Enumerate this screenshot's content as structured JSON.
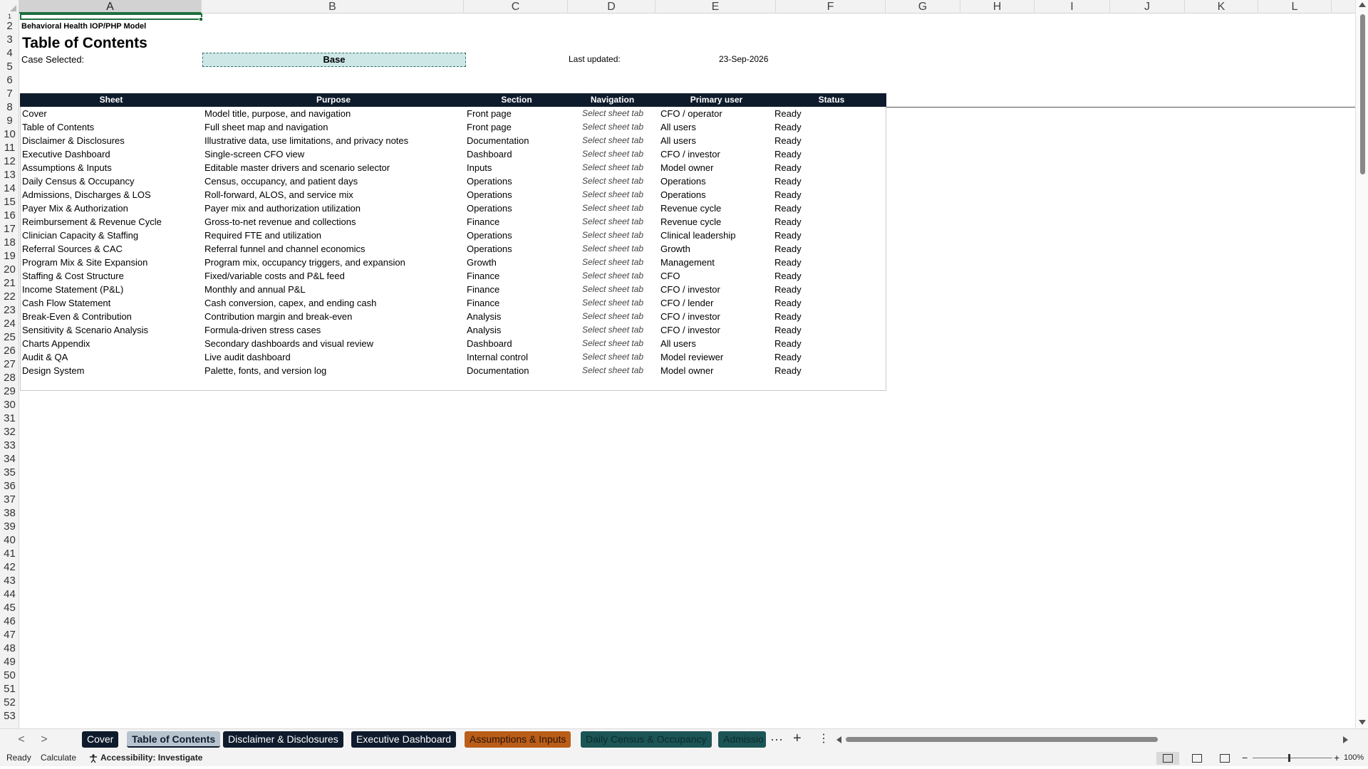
{
  "columns": [
    "A",
    "B",
    "C",
    "D",
    "E",
    "F",
    "G",
    "H",
    "I",
    "J",
    "K",
    "L"
  ],
  "rows": [
    "1",
    "2",
    "3",
    "4",
    "5",
    "6",
    "7",
    "8",
    "9",
    "10",
    "11",
    "12",
    "13",
    "14",
    "15",
    "16",
    "17",
    "18",
    "19",
    "20",
    "21",
    "22",
    "23",
    "24",
    "25",
    "26",
    "27",
    "28",
    "29",
    "30",
    "31",
    "32",
    "33",
    "34",
    "35",
    "36",
    "37",
    "38",
    "39",
    "40",
    "41",
    "42",
    "43",
    "44",
    "45",
    "46",
    "47",
    "48",
    "49",
    "50",
    "51",
    "52",
    "53"
  ],
  "sheet": {
    "model_name": "Behavioral Health IOP/PHP Model",
    "title": "Table of Contents",
    "case_label": "Case Selected:",
    "case_value": "Base",
    "updated_label": "Last updated:",
    "updated_value": "23-Sep-2026"
  },
  "toc": {
    "headers": [
      "Sheet",
      "Purpose",
      "Section",
      "Navigation",
      "Primary user",
      "Status"
    ],
    "rows": [
      [
        "Cover",
        "Model title, purpose, and navigation",
        "Front page",
        "Select sheet tab",
        "CFO / operator",
        "Ready"
      ],
      [
        "Table of Contents",
        "Full sheet map and navigation",
        "Front page",
        "Select sheet tab",
        "All users",
        "Ready"
      ],
      [
        "Disclaimer & Disclosures",
        "Illustrative data, use limitations, and privacy notes",
        "Documentation",
        "Select sheet tab",
        "All users",
        "Ready"
      ],
      [
        "Executive Dashboard",
        "Single-screen CFO view",
        "Dashboard",
        "Select sheet tab",
        "CFO / investor",
        "Ready"
      ],
      [
        "Assumptions & Inputs",
        "Editable master drivers and scenario selector",
        "Inputs",
        "Select sheet tab",
        "Model owner",
        "Ready"
      ],
      [
        "Daily Census & Occupancy",
        "Census, occupancy, and patient days",
        "Operations",
        "Select sheet tab",
        "Operations",
        "Ready"
      ],
      [
        "Admissions, Discharges & LOS",
        "Roll-forward, ALOS, and service mix",
        "Operations",
        "Select sheet tab",
        "Operations",
        "Ready"
      ],
      [
        "Payer Mix & Authorization",
        "Payer mix and authorization utilization",
        "Operations",
        "Select sheet tab",
        "Revenue cycle",
        "Ready"
      ],
      [
        "Reimbursement & Revenue Cycle",
        "Gross-to-net revenue and collections",
        "Finance",
        "Select sheet tab",
        "Revenue cycle",
        "Ready"
      ],
      [
        "Clinician Capacity & Staffing",
        "Required FTE and utilization",
        "Operations",
        "Select sheet tab",
        "Clinical leadership",
        "Ready"
      ],
      [
        "Referral Sources & CAC",
        "Referral funnel and channel economics",
        "Operations",
        "Select sheet tab",
        "Growth",
        "Ready"
      ],
      [
        "Program Mix & Site Expansion",
        "Program mix, occupancy triggers, and expansion",
        "Growth",
        "Select sheet tab",
        "Management",
        "Ready"
      ],
      [
        "Staffing & Cost Structure",
        "Fixed/variable costs and P&L feed",
        "Finance",
        "Select sheet tab",
        "CFO",
        "Ready"
      ],
      [
        "Income Statement (P&L)",
        "Monthly and annual P&L",
        "Finance",
        "Select sheet tab",
        "CFO / investor",
        "Ready"
      ],
      [
        "Cash Flow Statement",
        "Cash conversion, capex, and ending cash",
        "Finance",
        "Select sheet tab",
        "CFO / lender",
        "Ready"
      ],
      [
        "Break-Even & Contribution",
        "Contribution margin and break-even",
        "Analysis",
        "Select sheet tab",
        "CFO / investor",
        "Ready"
      ],
      [
        "Sensitivity & Scenario Analysis",
        "Formula-driven stress cases",
        "Analysis",
        "Select sheet tab",
        "CFO / investor",
        "Ready"
      ],
      [
        "Charts Appendix",
        "Secondary dashboards and visual review",
        "Dashboard",
        "Select sheet tab",
        "All users",
        "Ready"
      ],
      [
        "Audit & QA",
        "Live audit dashboard",
        "Internal control",
        "Select sheet tab",
        "Model reviewer",
        "Ready"
      ],
      [
        "Design System",
        "Palette, fonts, and version log",
        "Documentation",
        "Select sheet tab",
        "Model owner",
        "Ready"
      ]
    ]
  },
  "tabs": [
    {
      "label": "Cover",
      "style": "dark"
    },
    {
      "label": "Table of Contents",
      "style": "active"
    },
    {
      "label": "Disclaimer & Disclosures",
      "style": "dark"
    },
    {
      "label": "Executive Dashboard",
      "style": "dark"
    },
    {
      "label": "Assumptions & Inputs",
      "style": "orange"
    },
    {
      "label": "Daily Census & Occupancy",
      "style": "teal"
    },
    {
      "label": "Admissio",
      "style": "teal"
    }
  ],
  "tabbar": {
    "prev": "<",
    "next": ">",
    "more": "···",
    "add": "+",
    "menu": "⋮"
  },
  "status": {
    "ready": "Ready",
    "calculate": "Calculate",
    "accessibility": "Accessibility: Investigate",
    "zoom": "100%",
    "zoom_minus": "−",
    "zoom_plus": "+"
  },
  "colors": {
    "header_fill": "#0e1b2c",
    "input_fill": "#cde7e7",
    "assumptions_tab": "#b95d19",
    "operations_tab": "#1c5555",
    "selection": "#1e6e3e"
  }
}
